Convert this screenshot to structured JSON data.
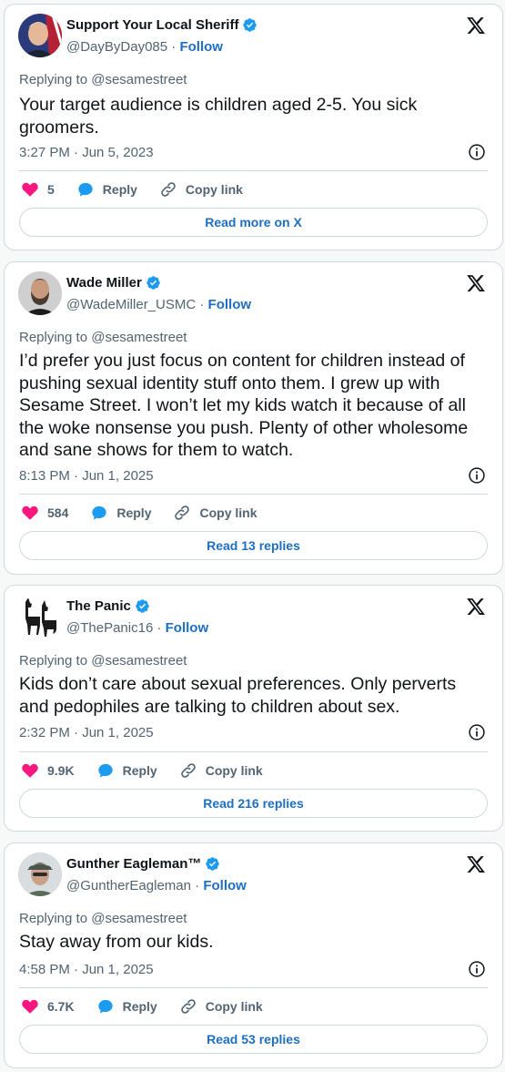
{
  "tweets": [
    {
      "name": "Support Your Local Sheriff",
      "handle": "@DayByDay085",
      "follow": "Follow",
      "replying": "Replying to @sesamestreet",
      "text": "Your target audience is children aged 2-5. You sick groomers.",
      "time": "3:27 PM · Jun 5, 2023",
      "likes": "5",
      "reply": "Reply",
      "copy": "Copy link",
      "cta": "Read more on X",
      "avatar": "man-with-flag-avatar"
    },
    {
      "name": "Wade Miller",
      "handle": "@WadeMiller_USMC",
      "follow": "Follow",
      "replying": "Replying to @sesamestreet",
      "text": "I’d prefer you just focus on content for children instead of pushing sexual identity stuff onto them. I grew up with Sesame Street. I won’t let my kids watch it because of all the woke nonsense you push. Plenty of other wholesome and sane shows for them to watch.",
      "time": "8:13 PM · Jun 1, 2025",
      "likes": "584",
      "reply": "Reply",
      "copy": "Copy link",
      "cta": "Read 13 replies",
      "avatar": "bearded-man-avatar"
    },
    {
      "name": "The Panic",
      "handle": "@ThePanic16",
      "follow": "Follow",
      "replying": "Replying to @sesamestreet",
      "text": "Kids don’t care about sexual preferences.  Only perverts and pedophiles are talking to children about sex.",
      "time": "2:32 PM · Jun 1, 2025",
      "likes": "9.9K",
      "reply": "Reply",
      "copy": "Copy link",
      "cta": "Read 216 replies",
      "avatar": "dogs-silhouette-avatar"
    },
    {
      "name": "Gunther Eagleman™",
      "handle": "@GuntherEagleman",
      "follow": "Follow",
      "replying": "Replying to @sesamestreet",
      "text": "Stay away from our kids.",
      "time": "4:58 PM · Jun 1, 2025",
      "likes": "6.7K",
      "reply": "Reply",
      "copy": "Copy link",
      "cta": "Read 53 replies",
      "avatar": "man-in-cap-avatar"
    }
  ],
  "colors": {
    "accent": "#1d9bf0",
    "link": "#1d6fc4",
    "heart": "#f91880",
    "muted": "#536471",
    "border": "#cfd9de"
  }
}
